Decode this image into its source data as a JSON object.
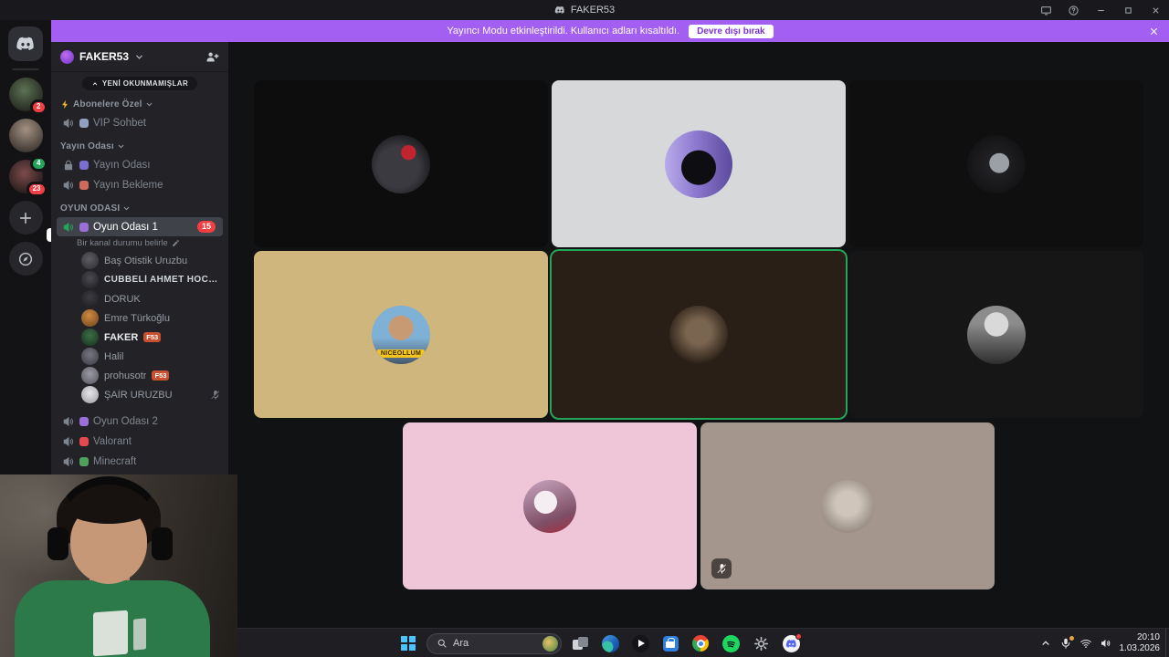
{
  "titlebar": {
    "title": "FAKER53"
  },
  "banner": {
    "text": "Yayıncı Modu etkinleştirildi. Kullanıcı adları kısaltıldı.",
    "dismiss_button": "Devre dışı bırak"
  },
  "rail": {
    "server1_badge": "2",
    "server3_badge_green": "4",
    "server3_badge": "23"
  },
  "sidebar": {
    "server_name": "FAKER53",
    "unread_pill": "YENİ OKUNMAMIŞLAR",
    "categories": {
      "subscribers": "Abonelere Özel",
      "stream": "Yayın Odası",
      "game": "OYUN ODASI"
    },
    "channels": [
      {
        "name": "VIP Sohbet"
      },
      {
        "name": "Yayın Odası"
      },
      {
        "name": "Yayın Bekleme"
      },
      {
        "name": "Oyun Odası 1",
        "badge": "15",
        "status_placeholder": "Bir kanal durumu belirle"
      },
      {
        "name": "Oyun Odası 2"
      },
      {
        "name": "Valorant"
      },
      {
        "name": "Minecraft"
      }
    ],
    "members": [
      {
        "name": "Baş Otistik Uruzbu"
      },
      {
        "name": "CÜBBELİ AHMET HOCA !!!"
      },
      {
        "name": "DORUK"
      },
      {
        "name": "Emre Türkoğlu"
      },
      {
        "name": "FAKER",
        "badge": "F53"
      },
      {
        "name": "Halil"
      },
      {
        "name": "prohusotr",
        "badge": "F53"
      },
      {
        "name": "ŞAİR URUZBU",
        "muted": true
      }
    ]
  },
  "call": {
    "tiles": [
      {
        "style": "background:#0d0d0e"
      },
      {
        "style": "background:#d6d8da"
      },
      {
        "style": "background:#0f0f10"
      },
      {
        "style": "background:#cfb67c",
        "avatar_text": "NICEOLLUM"
      },
      {
        "style": "background:#2a1f16",
        "speaking": true
      },
      {
        "style": "background:#161616"
      },
      {
        "style": "background:#eec6d8"
      },
      {
        "style": "background:#a4968c",
        "muted": true
      }
    ]
  },
  "taskbar": {
    "search_placeholder": "Ara",
    "time": "20:10",
    "date": "1.03.2026",
    "icons": [
      "start",
      "search",
      "task-view",
      "edge",
      "media-player",
      "microsoft-store",
      "chrome",
      "spotify",
      "settings",
      "discord"
    ]
  },
  "colors": {
    "banner_purple": "#a35ef2",
    "speaking_green": "#23a55a",
    "badge_red": "#f23f43"
  }
}
